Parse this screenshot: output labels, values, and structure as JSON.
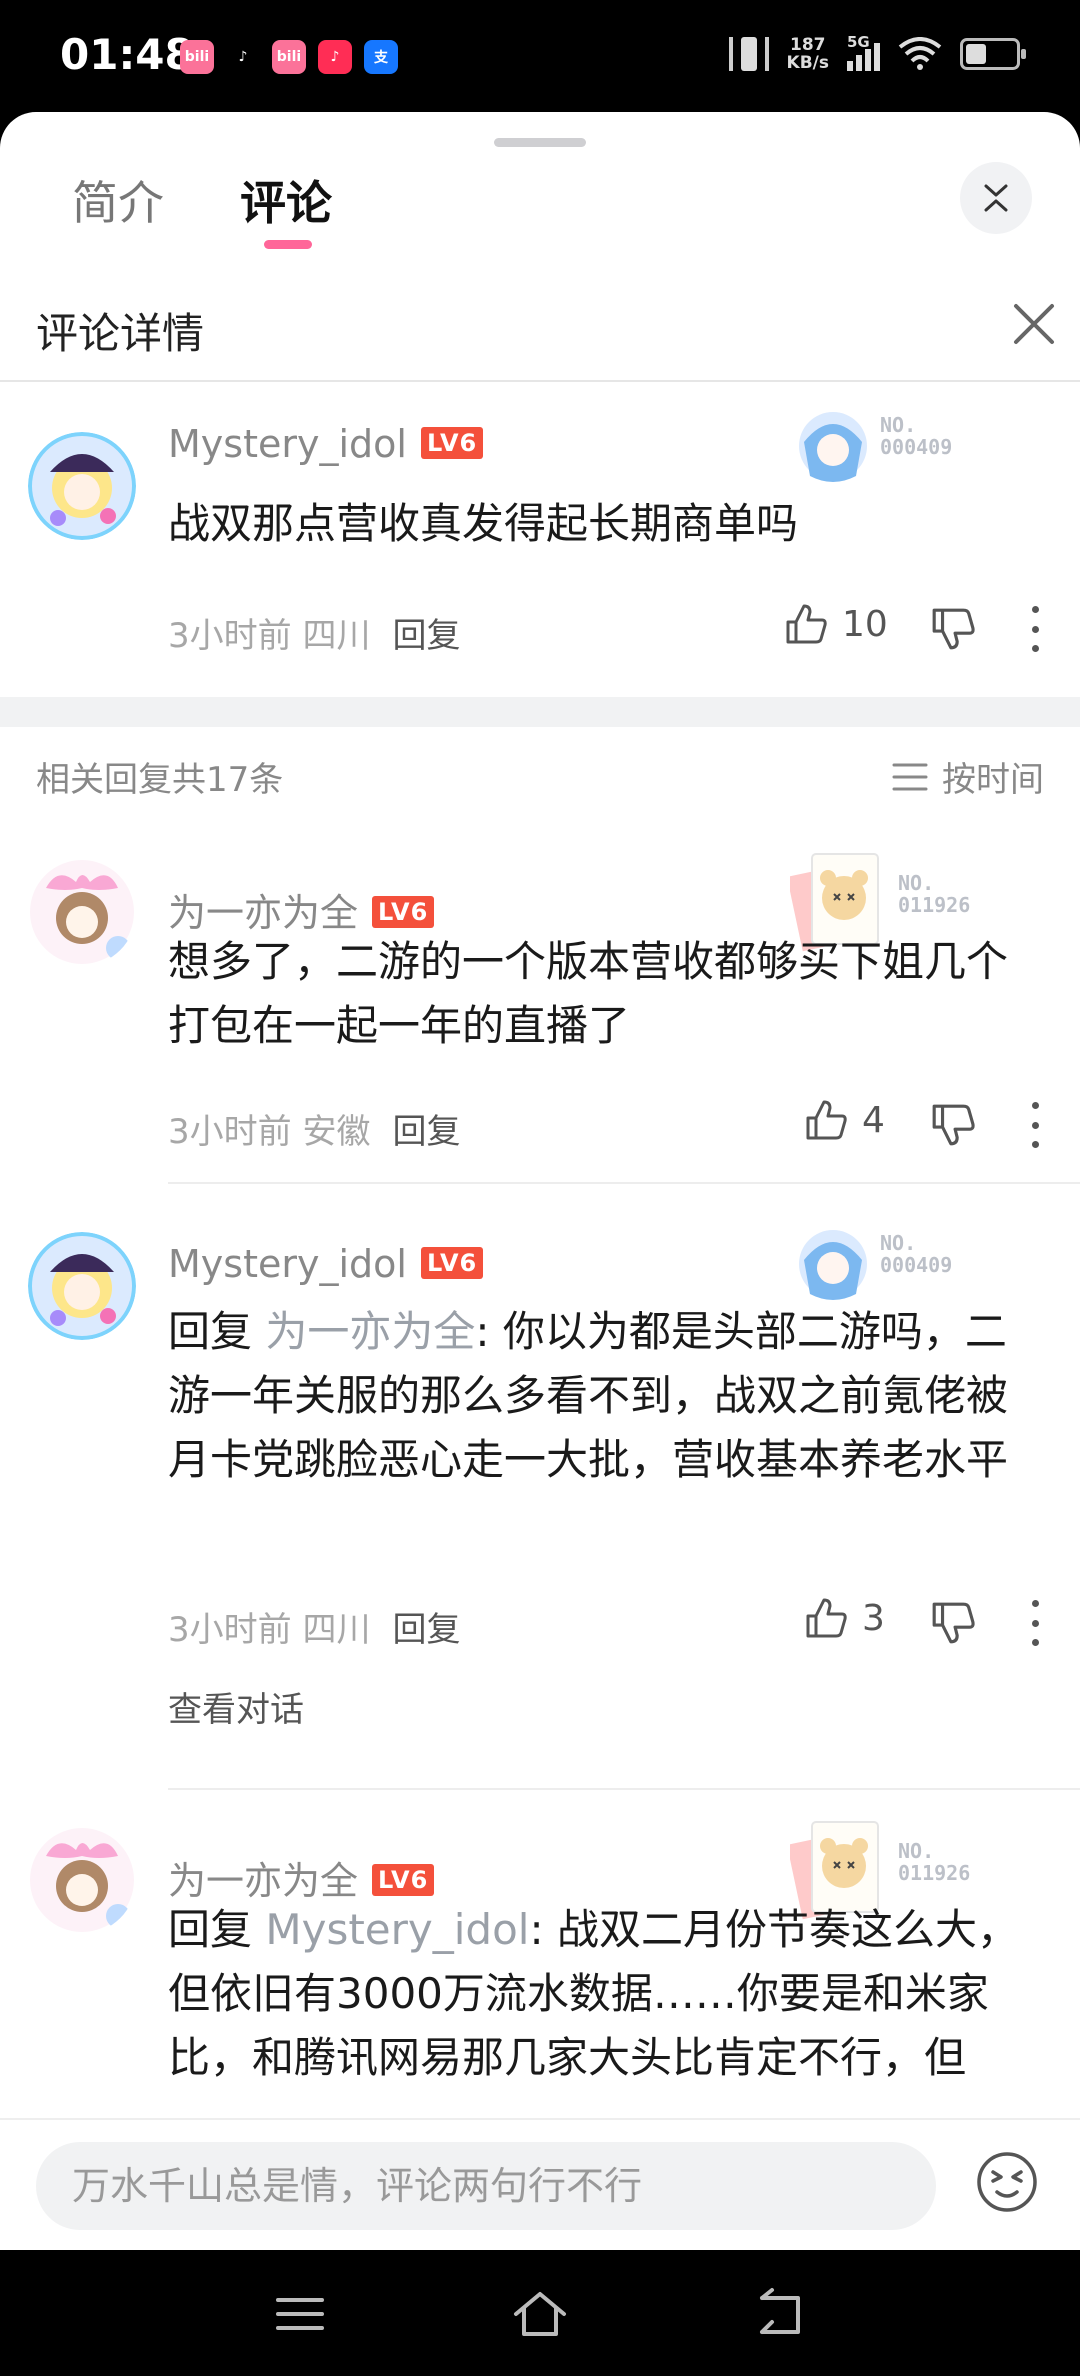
{
  "status_bar": {
    "time": "01:48",
    "apps": [
      {
        "name": "bilibili-app-icon",
        "label": "bili",
        "color": "#fb7299"
      },
      {
        "name": "tiktok-app-icon",
        "label": "♪",
        "color": "#000000"
      },
      {
        "name": "bilibili-app-icon-2",
        "label": "bili",
        "color": "#fb7299"
      },
      {
        "name": "music-app-icon",
        "label": "♪",
        "color": "#ff2d55"
      },
      {
        "name": "alipay-app-icon",
        "label": "支",
        "color": "#1677ff"
      }
    ],
    "net_speed_value": "187",
    "net_speed_unit": "KB/s",
    "network": "5G"
  },
  "tabs": [
    {
      "label": "简介",
      "active": false
    },
    {
      "label": "评论",
      "active": true
    }
  ],
  "detail_title": "评论详情",
  "main_comment": {
    "username": "Mystery_idol",
    "level": "LV6",
    "badge_no_1": "NO.",
    "badge_no_2": "000409",
    "text": "战双那点营收真发得起长期商单吗",
    "time": "3小时前",
    "location": "四川",
    "reply_label": "回复",
    "likes": "10"
  },
  "replies_header": {
    "count_label": "相关回复共17条",
    "sort_label": "按时间"
  },
  "replies": [
    {
      "username": "为一亦为全",
      "level": "LV6",
      "badge_no_1": "NO.",
      "badge_no_2": "011926",
      "text": "想多了，二游的一个版本营收都够买下姐几个打包在一起一年的直播了",
      "time": "3小时前",
      "location": "安徽",
      "reply_label": "回复",
      "likes": "4"
    },
    {
      "username": "Mystery_idol",
      "level": "LV6",
      "badge_no_1": "NO.",
      "badge_no_2": "000409",
      "prefix": "回复 ",
      "mention": "为一亦为全",
      "text": ": 你以为都是头部二游吗，二游一年关服的那么多看不到，战双之前氪佬被月卡党跳脸恶心走一大批，营收基本养老水平",
      "time": "3小时前",
      "location": "四川",
      "reply_label": "回复",
      "likes": "3",
      "view_convo": "查看对话"
    },
    {
      "username": "为一亦为全",
      "level": "LV6",
      "badge_no_1": "NO.",
      "badge_no_2": "011926",
      "prefix": "回复 ",
      "mention": "Mystery_idol",
      "text": ": 战双二月份节奏这么大，但依旧有3000万流水数据……你要是和米家比，和腾讯网易那几家大头比肯定不行，但"
    }
  ],
  "input": {
    "placeholder": "万水千山总是情，评论两句行不行"
  },
  "colors": {
    "accent": "#ff6699",
    "level_badge": "#f4503b"
  }
}
